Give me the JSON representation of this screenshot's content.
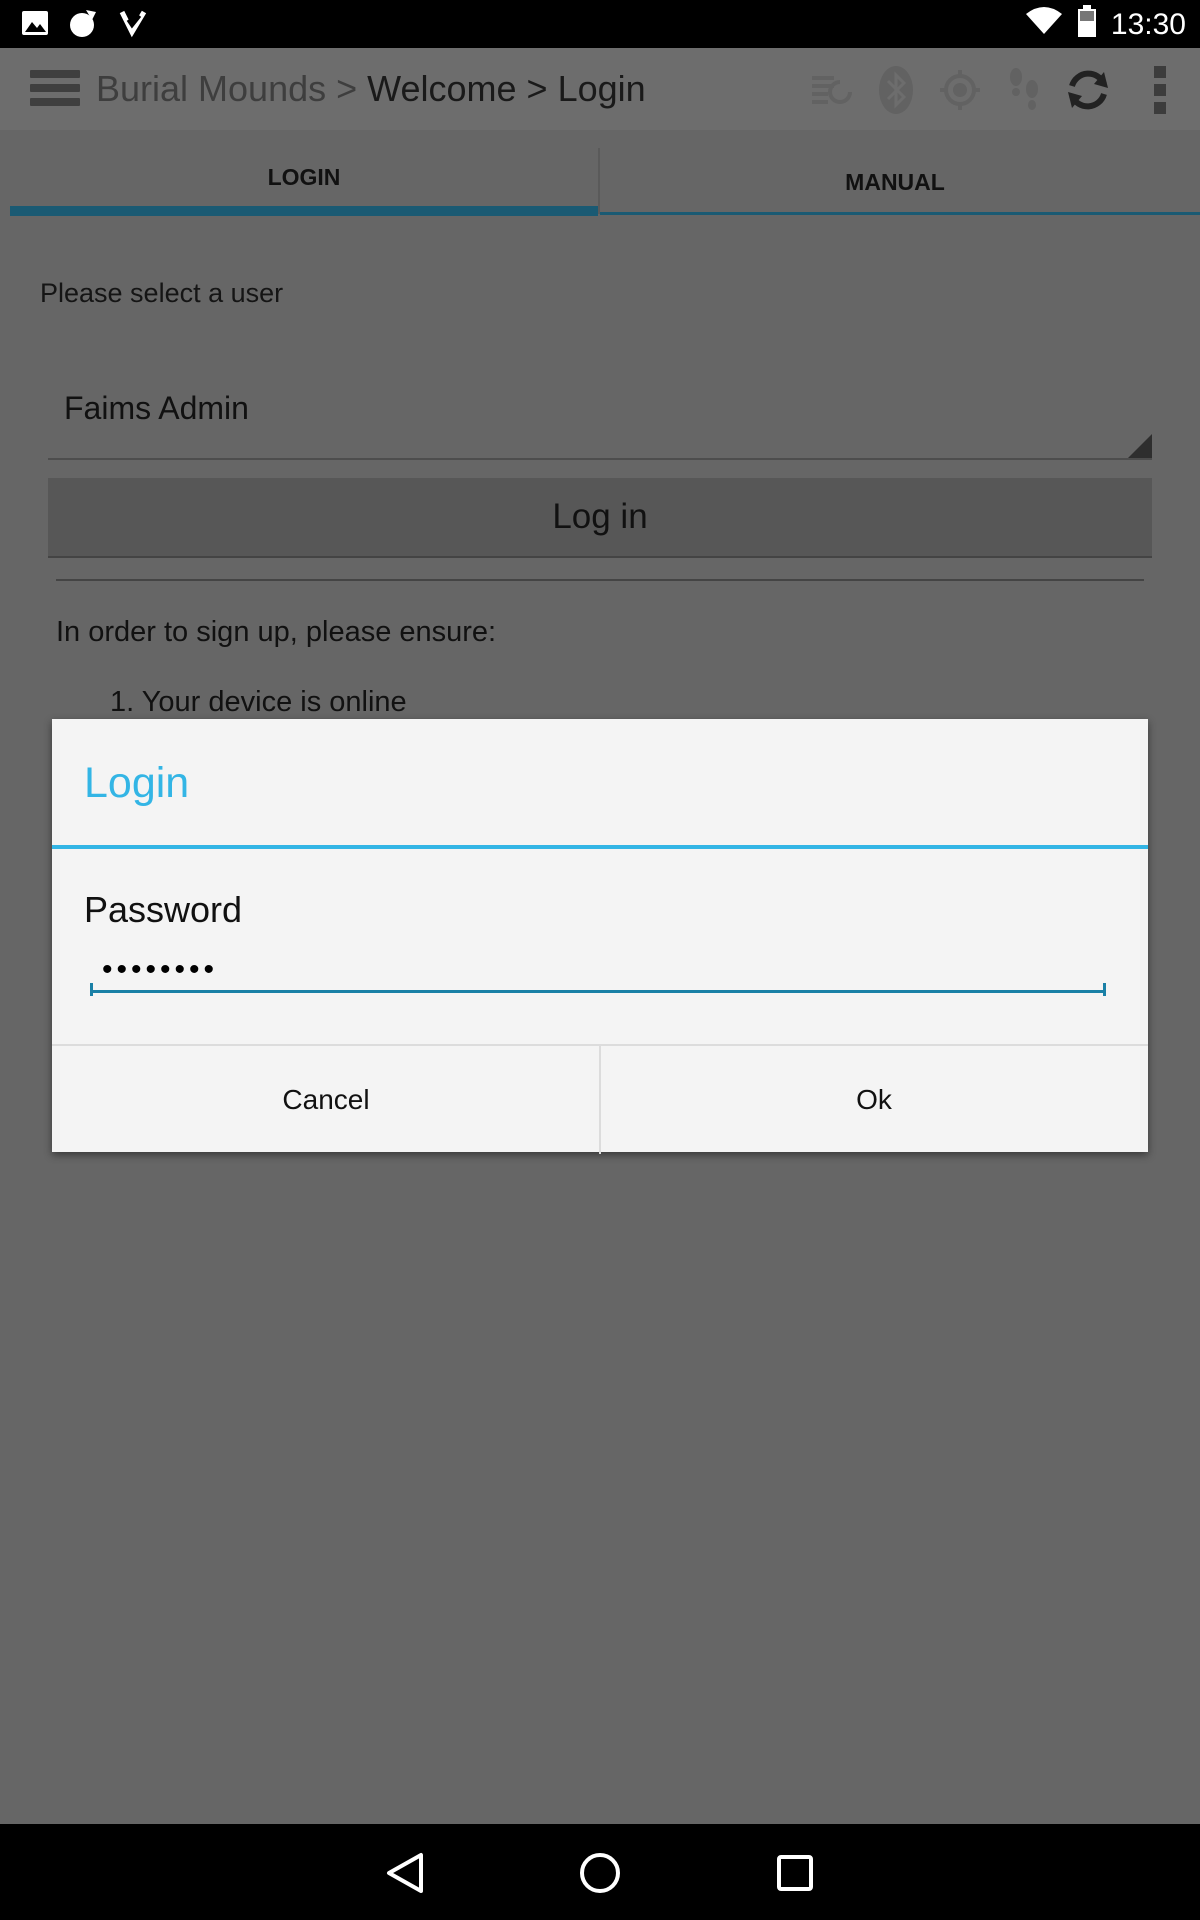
{
  "status_bar": {
    "left_icons": [
      "image-icon",
      "cat-icon",
      "download-check-icon"
    ],
    "time": "13:30",
    "right_icons": [
      "wifi-icon",
      "battery-icon"
    ]
  },
  "action_bar": {
    "breadcrumb_dim": "Burial Mounds > ",
    "breadcrumb_current": "Welcome > Login",
    "icons": [
      "sync-list-icon",
      "bluetooth-icon",
      "gps-icon",
      "tracking-icon",
      "sync-icon",
      "overflow-menu-icon"
    ]
  },
  "tabs": [
    {
      "label": "LOGIN",
      "active": true
    },
    {
      "label": "MANUAL",
      "active": false
    }
  ],
  "content": {
    "select_label": "Please select a user",
    "selected_user": "Faims Admin",
    "login_button": "Log in",
    "signup_text": "In order to sign up, please ensure:",
    "signup_step_1": "1. Your device is online"
  },
  "dialog": {
    "title": "Login",
    "password_label": "Password",
    "password_value": "••••••••",
    "cancel_label": "Cancel",
    "ok_label": "Ok"
  },
  "colors": {
    "accent": "#33b5e5",
    "tab_indicator": "#1a5a73",
    "overlay": "#666666"
  }
}
